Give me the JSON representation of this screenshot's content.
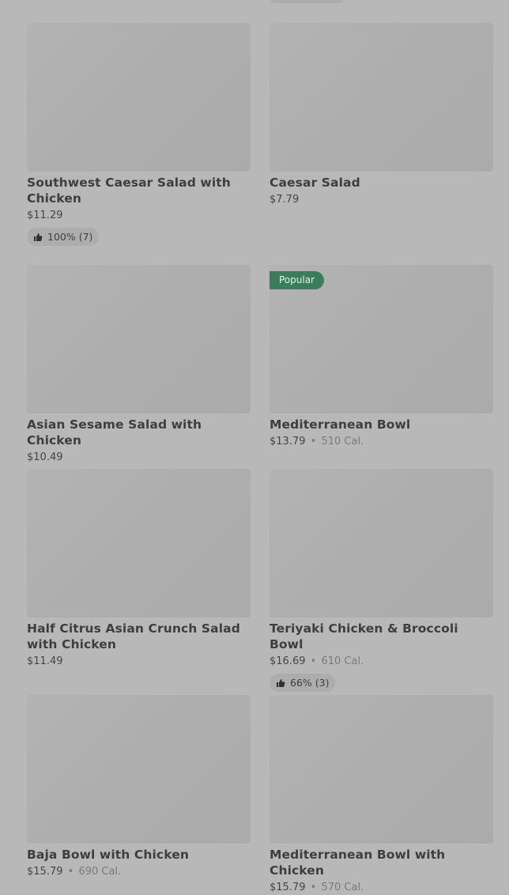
{
  "items": [
    {
      "title": "Southwest Caesar Salad with Chicken",
      "price": "$11.29",
      "calories": "",
      "rating": "100% (7)",
      "badge": ""
    },
    {
      "title": "Caesar Salad",
      "price": "$7.79",
      "calories": "",
      "rating": "",
      "badge": ""
    },
    {
      "title": "Asian Sesame Salad with Chicken",
      "price": "$10.49",
      "calories": "",
      "rating": "",
      "badge": ""
    },
    {
      "title": "Mediterranean Bowl",
      "price": "$13.79",
      "calories": "510 Cal.",
      "rating": "",
      "badge": "Popular"
    },
    {
      "title": "Half Citrus Asian Crunch Salad with Chicken",
      "price": "$11.49",
      "calories": "",
      "rating": "",
      "badge": ""
    },
    {
      "title": "Teriyaki Chicken & Broccoli Bowl",
      "price": "$16.69",
      "calories": "610 Cal.",
      "rating": "66% (3)",
      "badge": ""
    },
    {
      "title": "Baja Bowl with Chicken",
      "price": "$15.79",
      "calories": "690 Cal.",
      "rating": "",
      "badge": ""
    },
    {
      "title": "Mediterranean Bowl with Chicken",
      "price": "$15.79",
      "calories": "570 Cal.",
      "rating": "",
      "badge": ""
    }
  ],
  "separator": "•",
  "icons": {
    "rating": "thumbs-up-icon"
  },
  "colors": {
    "popular_badge": "#3a7d5a",
    "background": "#b8b8b8"
  }
}
